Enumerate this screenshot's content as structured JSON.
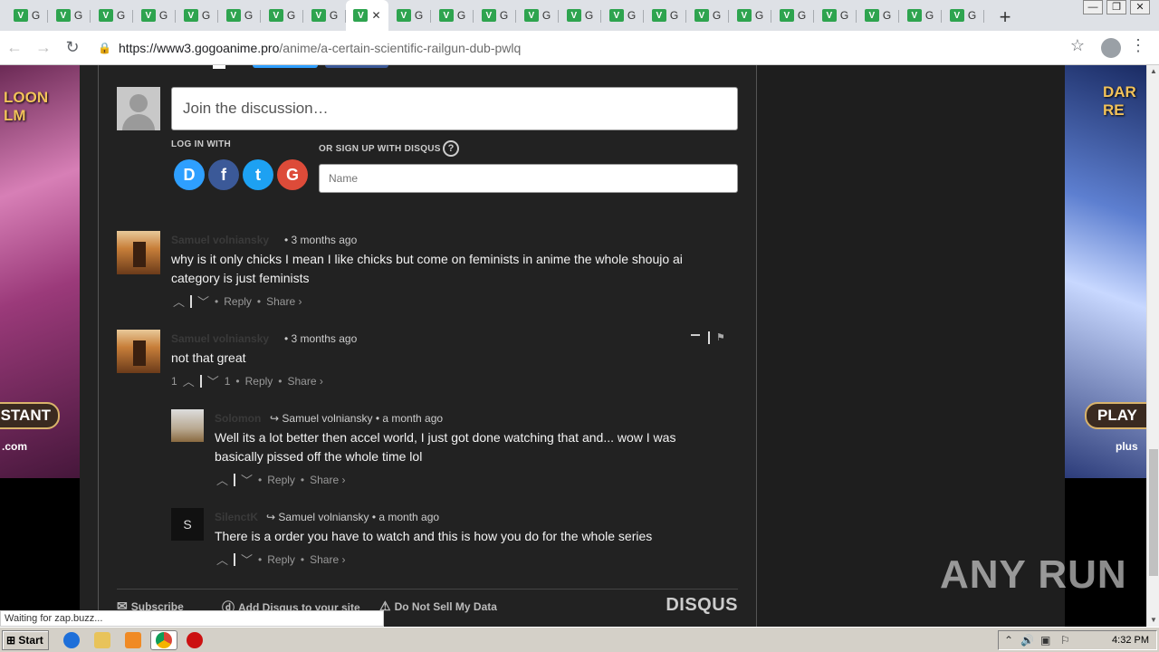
{
  "browser": {
    "tabs": [
      {
        "label": "G",
        "active": false
      },
      {
        "label": "G",
        "active": false
      },
      {
        "label": "G",
        "active": false
      },
      {
        "label": "G",
        "active": false
      },
      {
        "label": "G",
        "active": false
      },
      {
        "label": "G",
        "active": false
      },
      {
        "label": "G",
        "active": false
      },
      {
        "label": "G",
        "active": false
      },
      {
        "label": "",
        "active": true
      },
      {
        "label": "G",
        "active": false
      },
      {
        "label": "G",
        "active": false
      },
      {
        "label": "G",
        "active": false
      },
      {
        "label": "G",
        "active": false
      },
      {
        "label": "G",
        "active": false
      },
      {
        "label": "G",
        "active": false
      },
      {
        "label": "G",
        "active": false
      },
      {
        "label": "G",
        "active": false
      },
      {
        "label": "G",
        "active": false
      },
      {
        "label": "G",
        "active": false
      },
      {
        "label": "G",
        "active": false
      },
      {
        "label": "G",
        "active": false
      },
      {
        "label": "G",
        "active": false
      },
      {
        "label": "G",
        "active": false
      }
    ],
    "new_tab_label": "+",
    "url_host": "https://www3.gogoanime.pro",
    "url_path": "/anime/a-certain-scientific-railgun-dub-pwlq",
    "status_text": "Waiting for zap.buzz..."
  },
  "ads": {
    "left": {
      "logo": "LOON\nLM",
      "cta": "STANT",
      "domain": ".com"
    },
    "right": {
      "logo": "DAR\nRE",
      "cta": "PLAY",
      "domain": "plus"
    }
  },
  "disqus": {
    "discussion_placeholder": "Join the discussion…",
    "login_with": "LOG IN WITH",
    "signup_label": "OR SIGN UP WITH DISQUS",
    "help_symbol": "?",
    "social": {
      "disqus": "D",
      "facebook": "f",
      "twitter": "t",
      "google": "G"
    },
    "name_placeholder": "Name",
    "comments": [
      {
        "author": "Samuel volniansky",
        "meta": "• 3 months ago",
        "text": "why is it only chicks I mean I like chicks but come on feminists in anime the whole shoujo ai category is just feminists",
        "up": "",
        "down": "",
        "reply": "Reply",
        "share": "Share ›"
      },
      {
        "author": "Samuel volniansky",
        "meta": "• 3 months ago",
        "text": "not that great",
        "up": "1",
        "down": "1",
        "reply": "Reply",
        "share": "Share ›"
      },
      {
        "author": "Solomon",
        "reply_to": "Samuel volniansky",
        "meta": "• a month ago",
        "text": "Well its a lot better then accel world, I just got done watching that and... wow I was basically pissed off the whole time lol",
        "reply": "Reply",
        "share": "Share ›"
      },
      {
        "author": "SilenctK",
        "reply_to": "Samuel volniansky",
        "meta": "• a month ago",
        "text": "There is a order you have to watch and this is how you do for the whole series",
        "reply": "Reply",
        "share": "Share ›",
        "avatar_text": "S"
      }
    ],
    "footer": {
      "subscribe": "Subscribe",
      "add_disqus": "Add Disqus to your site",
      "do_not_sell": "Do Not Sell My Data",
      "logo": "DISQUS"
    }
  },
  "watermark": "ANY RUN",
  "taskbar": {
    "start": "Start",
    "clock": "4:32 PM"
  }
}
